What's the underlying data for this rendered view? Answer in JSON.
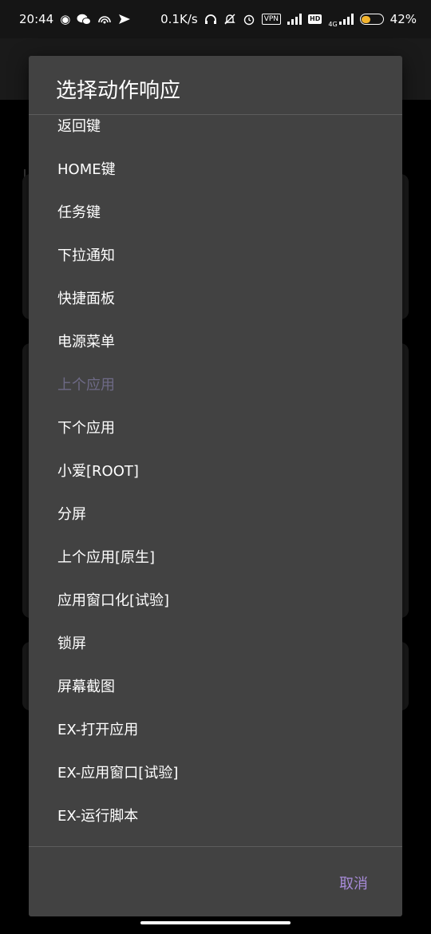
{
  "status_bar": {
    "time": "20:44",
    "net_speed": "0.1K/s",
    "vpn": "VPN",
    "hd": "HD",
    "network": "4G",
    "battery_level": 0.42,
    "battery": "42%",
    "battery_color": "#f2b32d"
  },
  "dialog": {
    "title": "选择动作响应",
    "options": [
      {
        "label": "返回键",
        "enabled": true
      },
      {
        "label": "HOME键",
        "enabled": true
      },
      {
        "label": "任务键",
        "enabled": true
      },
      {
        "label": "下拉通知",
        "enabled": true
      },
      {
        "label": "快捷面板",
        "enabled": true
      },
      {
        "label": "电源菜单",
        "enabled": true
      },
      {
        "label": "上个应用",
        "enabled": false
      },
      {
        "label": "下个应用",
        "enabled": true
      },
      {
        "label": "小爱[ROOT]",
        "enabled": true
      },
      {
        "label": "分屏",
        "enabled": true
      },
      {
        "label": "上个应用[原生]",
        "enabled": true
      },
      {
        "label": "应用窗口化[试验]",
        "enabled": true
      },
      {
        "label": "锁屏",
        "enabled": true
      },
      {
        "label": "屏幕截图",
        "enabled": true
      },
      {
        "label": "EX-打开应用",
        "enabled": true
      },
      {
        "label": "EX-应用窗口[试验]",
        "enabled": true
      },
      {
        "label": "EX-运行脚本",
        "enabled": true
      }
    ],
    "cancel_label": "取消",
    "accent_color": "#a78bd8",
    "background_color": "#424242",
    "disabled_color": "#6e6a86"
  }
}
